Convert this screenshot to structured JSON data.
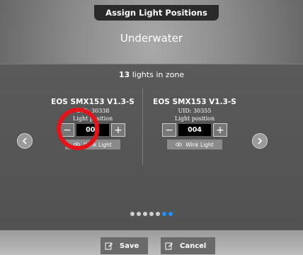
{
  "header": {
    "title": "Assign Light Positions"
  },
  "zone": {
    "name": "Underwater",
    "count": "13",
    "count_suffix": " lights in zone"
  },
  "cards": [
    {
      "device": "EOS SMX153 V1.3-S",
      "uid": "UID: 30338",
      "uid_visible": "30338",
      "position_label": "Light position",
      "position": "001",
      "minus": "−",
      "plus": "+",
      "wink": "Wink Light"
    },
    {
      "device": "EOS SMX153 V1.3-S",
      "uid": "UID: 30355",
      "position_label": "Light position",
      "position": "004",
      "minus": "−",
      "plus": "+",
      "wink": "Wink Light"
    }
  ],
  "pagination": {
    "total": 7,
    "active": [
      5,
      6
    ]
  },
  "actions": {
    "save": "Save",
    "cancel": "Cancel"
  },
  "colors": {
    "accent": "#1e90ff",
    "highlight": "#e3141a"
  },
  "icons": {
    "prev": "chevron-left-icon",
    "next": "chevron-right-icon",
    "wink": "eye-icon",
    "edit": "edit-icon"
  }
}
